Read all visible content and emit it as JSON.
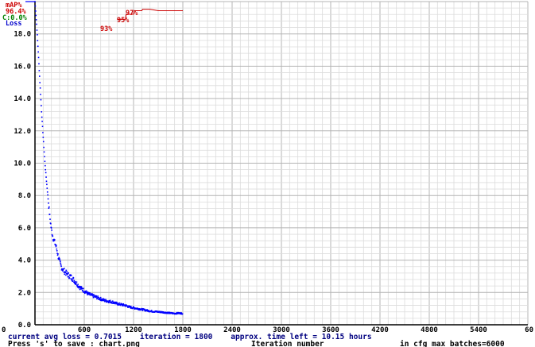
{
  "chart_data": {
    "type": "line",
    "title": "",
    "xlabel": "Iteration number",
    "ylabel": "",
    "xlim": [
      0,
      6000
    ],
    "ylim": [
      0,
      20
    ],
    "x_ticks": [
      0,
      600,
      1200,
      1800,
      2400,
      3000,
      3600,
      4200,
      4800,
      5400,
      6000
    ],
    "x_tick_labels": [
      "0",
      "600",
      "1200",
      "1800",
      "2400",
      "3000",
      "3600",
      "4200",
      "4800",
      "5400",
      "60"
    ],
    "y_ticks": [
      0,
      2,
      4,
      6,
      8,
      10,
      12,
      14,
      16,
      18,
      20
    ],
    "y_tick_labels": [
      "0.0",
      "2.0",
      "4.0",
      "6.0",
      "8.0",
      "10.0",
      "12.0",
      "14.0",
      "16.0",
      "18.0",
      ""
    ],
    "grid": true,
    "legend": {
      "position": "top-left",
      "entries": [
        {
          "label": "mAP%",
          "color": "#cc0000"
        },
        {
          "label": "96.4%",
          "color": "#cc0000"
        },
        {
          "label": "C:0.0%",
          "color": "#008000"
        },
        {
          "label": "Loss",
          "color": "#0000cc"
        }
      ]
    },
    "series": [
      {
        "name": "Loss",
        "color": "#0000ff",
        "style": "points",
        "x": [
          0,
          20,
          40,
          60,
          80,
          100,
          120,
          140,
          160,
          180,
          200,
          220,
          240,
          260,
          280,
          300,
          320,
          340,
          360,
          380,
          400,
          450,
          500,
          550,
          600,
          650,
          700,
          750,
          800,
          850,
          900,
          950,
          1000,
          1050,
          1100,
          1150,
          1200,
          1250,
          1300,
          1350,
          1400,
          1450,
          1500,
          1550,
          1600,
          1650,
          1700,
          1750,
          1800
        ],
        "y": [
          20.0,
          18.6,
          16.9,
          15.0,
          13.2,
          11.6,
          10.1,
          8.9,
          7.8,
          6.7,
          5.9,
          5.4,
          5.1,
          4.8,
          4.3,
          3.9,
          3.6,
          3.4,
          3.3,
          3.2,
          3.1,
          2.9,
          2.6,
          2.3,
          2.1,
          1.9,
          1.8,
          1.7,
          1.6,
          1.5,
          1.45,
          1.4,
          1.3,
          1.25,
          1.2,
          1.1,
          1.05,
          1.0,
          0.95,
          0.9,
          0.85,
          0.82,
          0.8,
          0.78,
          0.75,
          0.72,
          0.7,
          0.72,
          0.7
        ]
      },
      {
        "name": "mAP%",
        "color": "#cc0000",
        "style": "line",
        "x": [
          1000,
          1100,
          1110,
          1200,
          1210,
          1300,
          1310,
          1400,
          1500,
          1600,
          1700,
          1800
        ],
        "y": [
          93.0,
          93.0,
          95.0,
          95.0,
          96.4,
          96.4,
          97.0,
          97.0,
          96.4,
          96.4,
          96.4,
          96.4
        ]
      }
    ],
    "annotations": [
      "93%",
      "95%",
      "97%"
    ]
  },
  "status": {
    "line1": "current avg loss = 0.7015    iteration = 1800    approx. time left = 10.15 hours",
    "line2_left": "Press 's' to save : chart.png",
    "line2_mid": "Iteration number",
    "line2_right": "in cfg max_batches=6000"
  },
  "colors": {
    "grid_minor": "#dcdcdc",
    "grid_major": "#b4b4b4",
    "axis": "#000000",
    "loss": "#0000ff",
    "map": "#cc0000"
  }
}
